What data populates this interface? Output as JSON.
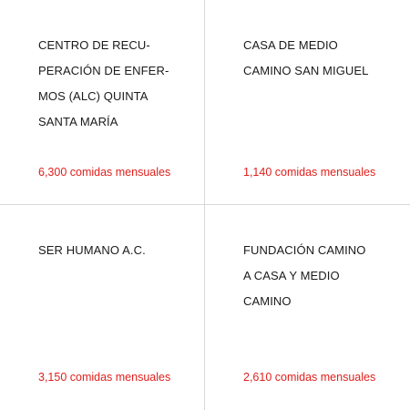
{
  "cards": [
    {
      "name_lines": [
        "CENTRO DE RECU-",
        "PERACIÓN DE ENFER-",
        "MOS (ALC) QUINTA",
        "SANTA MARÍA"
      ],
      "meals": "6,300 comidas mensuales"
    },
    {
      "name_lines": [
        "CASA DE MEDIO",
        "CAMINO SAN MIGUEL"
      ],
      "meals": "1,140 comidas mensuales"
    },
    {
      "name_lines": [
        "SER HUMANO A.C."
      ],
      "meals": "3,150 comidas mensuales"
    },
    {
      "name_lines": [
        "FUNDACIÓN CAMINO",
        "A CASA Y MEDIO",
        "CAMINO"
      ],
      "meals": "2,610 comidas mensuales"
    }
  ],
  "colors": {
    "text": "#1a1a1a",
    "accent": "#e0201c",
    "divider": "#d9d9d9"
  }
}
